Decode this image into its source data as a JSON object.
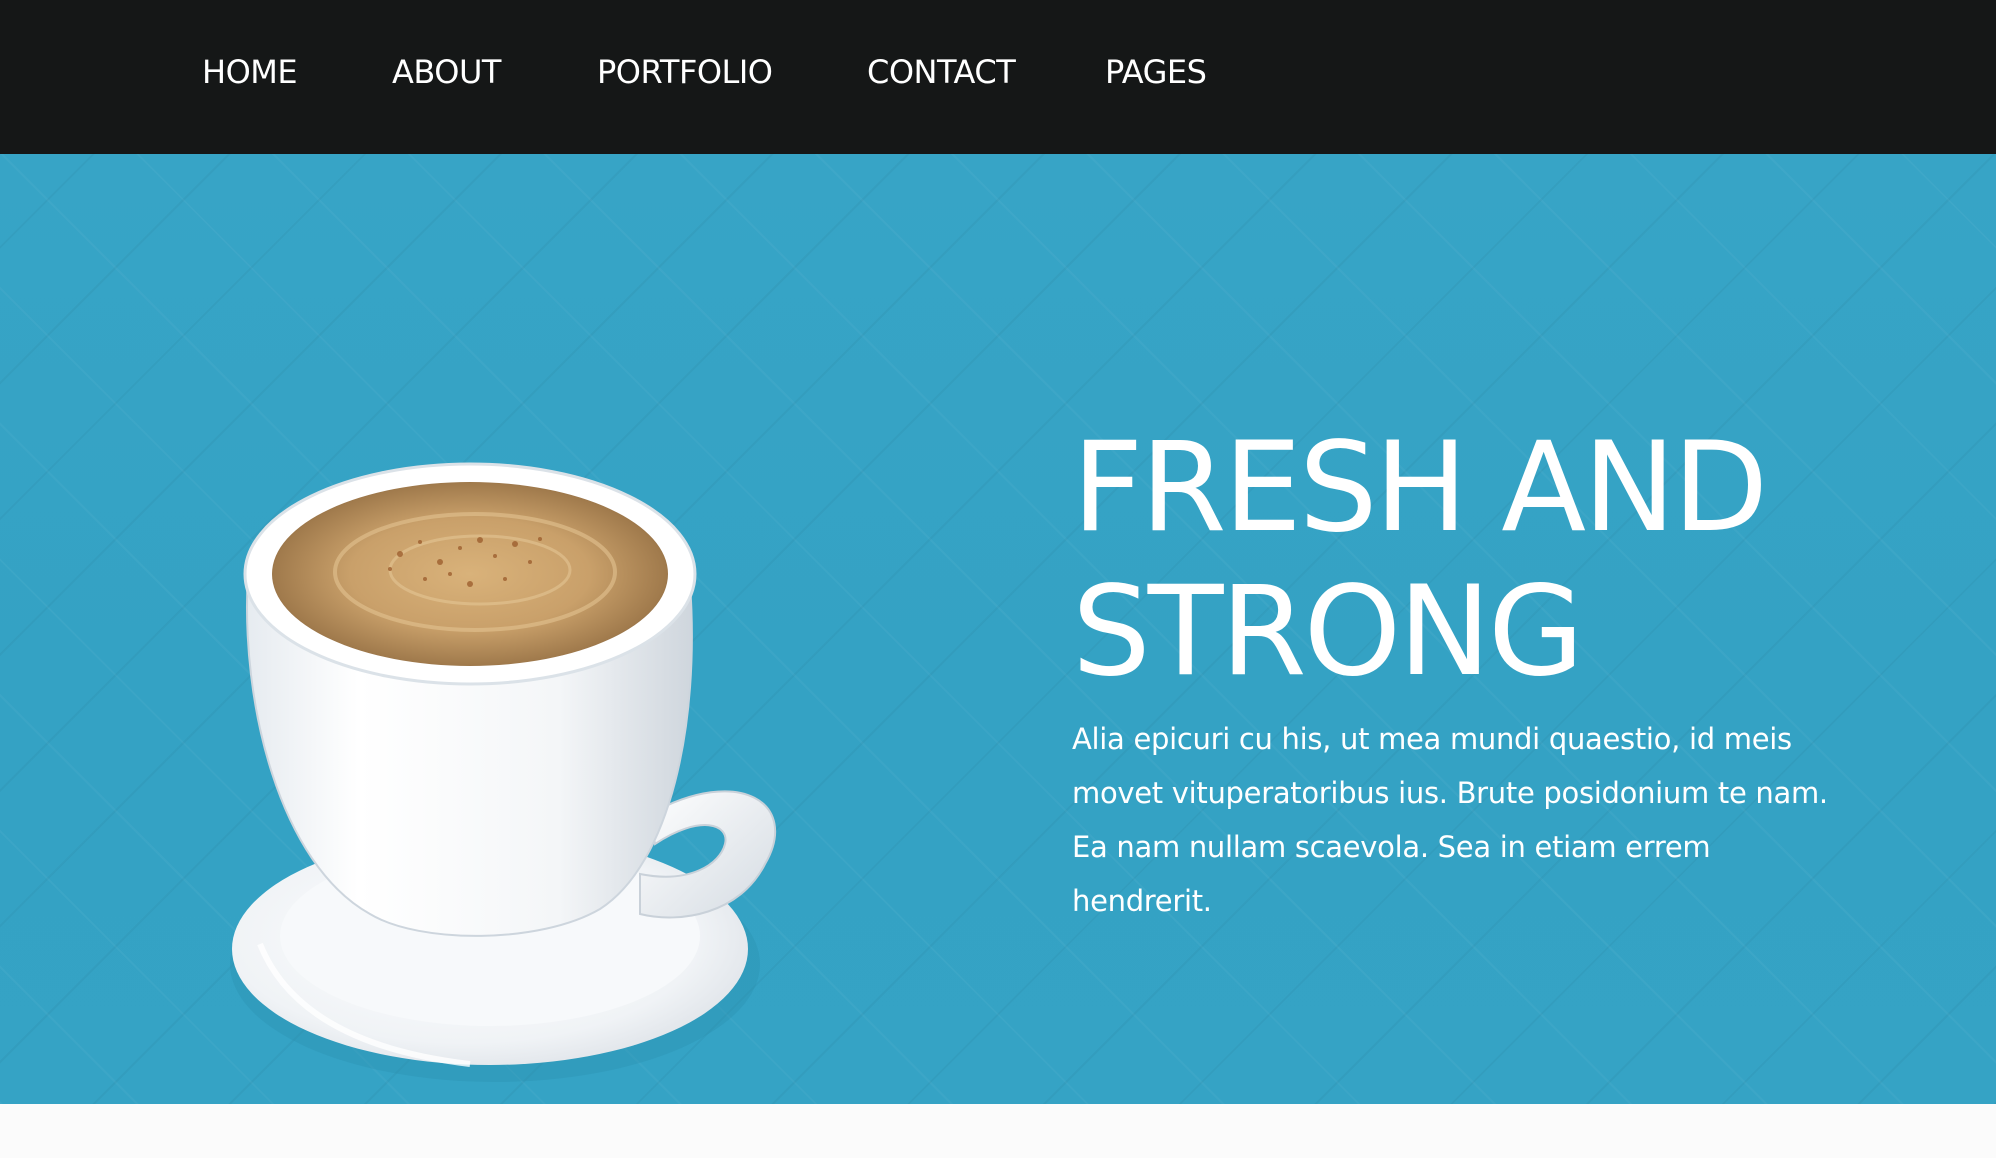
{
  "nav": {
    "items": [
      {
        "label": "HOME"
      },
      {
        "label": "ABOUT"
      },
      {
        "label": "PORTFOLIO"
      },
      {
        "label": "CONTACT"
      },
      {
        "label": "PAGES"
      }
    ]
  },
  "hero": {
    "image_alt": "coffee-cup-image",
    "title": "FRESH AND STRONG",
    "description": "Alia epicuri cu his, ut mea mundi quaestio, id meis movet vituperatoribus ius. Brute posidonium te nam. Ea nam nullam scaevola. Sea in etiam errem hendrerit."
  },
  "colors": {
    "nav_background": "#151717",
    "hero_background": "#35a3c6",
    "text": "#ffffff",
    "page_background": "#fbfbfb"
  }
}
